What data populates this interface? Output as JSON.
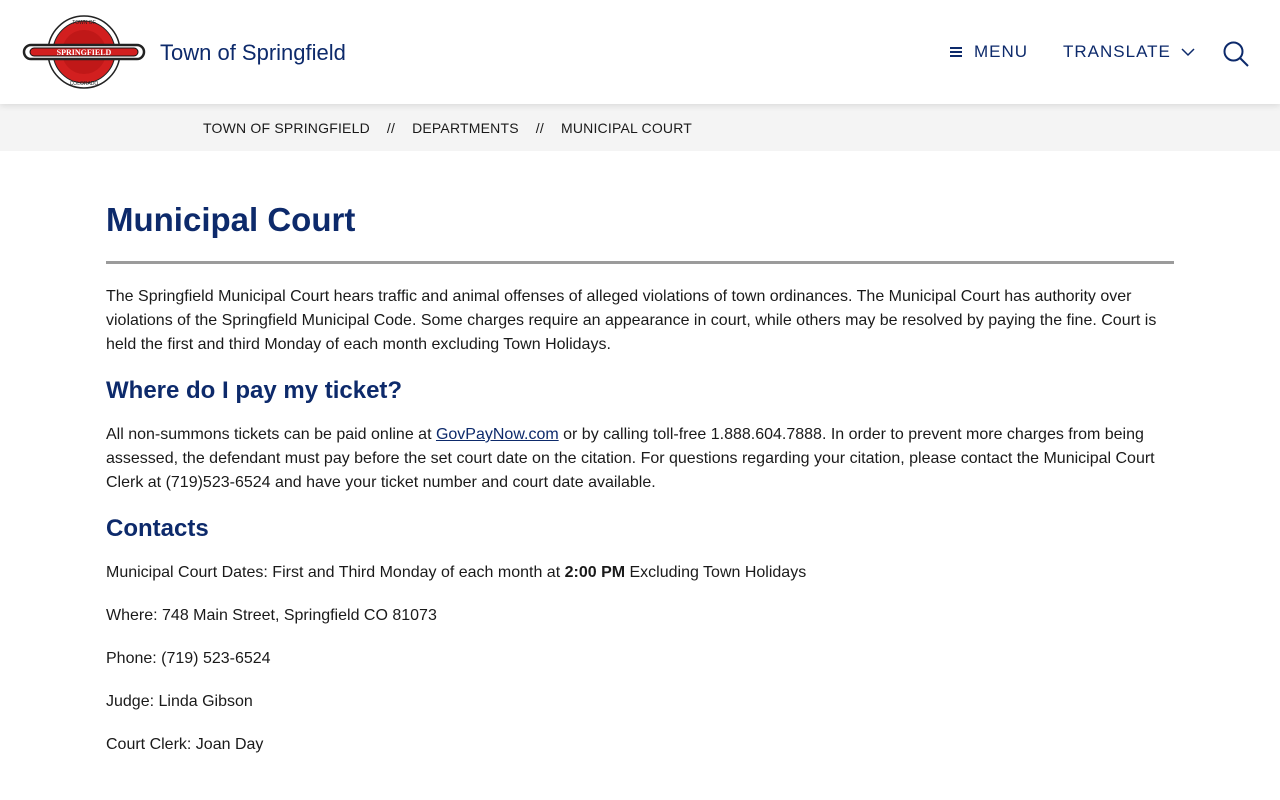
{
  "header": {
    "logo_text_top": "TOWN OF",
    "logo_text_main": "SPRINGFIELD",
    "logo_text_bottom": "COLORADO",
    "site_title": "Town of Springfield",
    "menu_label": "MENU",
    "translate_label": "TRANSLATE",
    "icons": [
      "hamburger-icon",
      "chevron-down-icon",
      "search-icon"
    ]
  },
  "breadcrumb": {
    "items": [
      "TOWN OF SPRINGFIELD",
      "DEPARTMENTS",
      "MUNICIPAL COURT"
    ],
    "separator": "//"
  },
  "main": {
    "title": "Municipal Court",
    "intro": "The Springfield Municipal Court hears traffic and animal offenses of alleged violations of town ordinances. The Municipal Court has authority over violations of the Springfield Municipal Code. Some charges require an appearance in court, while others may be resolved by paying the fine. Court is held the first and third Monday of each month excluding Town Holidays.",
    "pay_heading": "Where do I pay my ticket?",
    "pay_text_before": "All non-summons tickets can be paid online at ",
    "pay_link": "GovPayNow.com",
    "pay_text_after": " or by calling toll-free 1.888.604.7888. In order to prevent more charges from being assessed, the defendant must pay before the set court date on the citation. For questions regarding your citation, please contact the Municipal Court Clerk at (719)523-6524 and have your ticket number and court date available.",
    "contacts_heading": "Contacts",
    "dates_prefix": "Municipal Court Dates: First and Third Monday of each month at ",
    "dates_time": "2:00 PM",
    "dates_suffix": " Excluding Town Holidays",
    "where": "Where: 748 Main Street, Springfield CO 81073",
    "phone": "Phone: (719) 523-6524",
    "judge": "Judge: Linda Gibson",
    "clerk": "Court Clerk: Joan Day"
  },
  "colors": {
    "brand_navy": "#0d2a6b",
    "logo_red": "#d21f1f",
    "breadcrumb_bg": "#f4f4f4",
    "rule_gray": "#9b9b9b"
  }
}
